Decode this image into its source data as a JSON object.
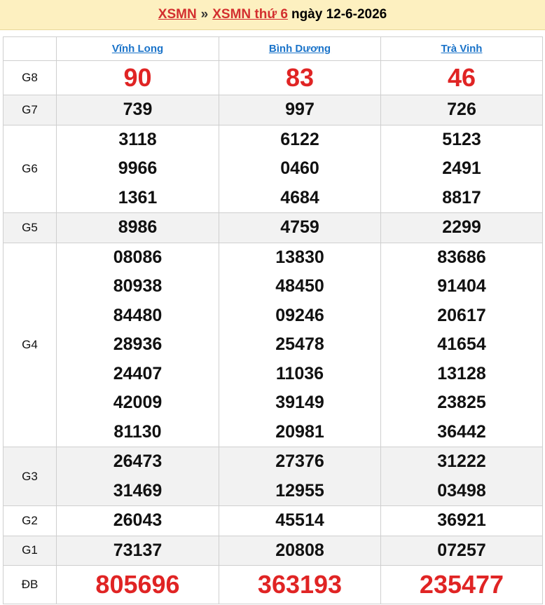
{
  "header": {
    "xsmn": "XSMN",
    "sep": "»",
    "xsmn_day": "XSMN thứ 6",
    "date": "ngày 12-6-2026"
  },
  "provinces": [
    "Vĩnh Long",
    "Bình Dương",
    "Trà Vinh"
  ],
  "prizes": {
    "G8": {
      "label": "G8",
      "values": [
        [
          "90"
        ],
        [
          "83"
        ],
        [
          "46"
        ]
      ]
    },
    "G7": {
      "label": "G7",
      "values": [
        [
          "739"
        ],
        [
          "997"
        ],
        [
          "726"
        ]
      ]
    },
    "G6": {
      "label": "G6",
      "values": [
        [
          "3118",
          "9966",
          "1361"
        ],
        [
          "6122",
          "0460",
          "4684"
        ],
        [
          "5123",
          "2491",
          "8817"
        ]
      ]
    },
    "G5": {
      "label": "G5",
      "values": [
        [
          "8986"
        ],
        [
          "4759"
        ],
        [
          "2299"
        ]
      ]
    },
    "G4": {
      "label": "G4",
      "values": [
        [
          "08086",
          "80938",
          "84480",
          "28936",
          "24407",
          "42009",
          "81130"
        ],
        [
          "13830",
          "48450",
          "09246",
          "25478",
          "11036",
          "39149",
          "20981"
        ],
        [
          "83686",
          "91404",
          "20617",
          "41654",
          "13128",
          "23825",
          "36442"
        ]
      ]
    },
    "G3": {
      "label": "G3",
      "values": [
        [
          "26473",
          "31469"
        ],
        [
          "27376",
          "12955"
        ],
        [
          "31222",
          "03498"
        ]
      ]
    },
    "G2": {
      "label": "G2",
      "values": [
        [
          "26043"
        ],
        [
          "45514"
        ],
        [
          "36921"
        ]
      ]
    },
    "G1": {
      "label": "G1",
      "values": [
        [
          "73137"
        ],
        [
          "20808"
        ],
        [
          "07257"
        ]
      ]
    },
    "DB": {
      "label": "ĐB",
      "values": [
        [
          "805696"
        ],
        [
          "363193"
        ],
        [
          "235477"
        ]
      ]
    }
  }
}
